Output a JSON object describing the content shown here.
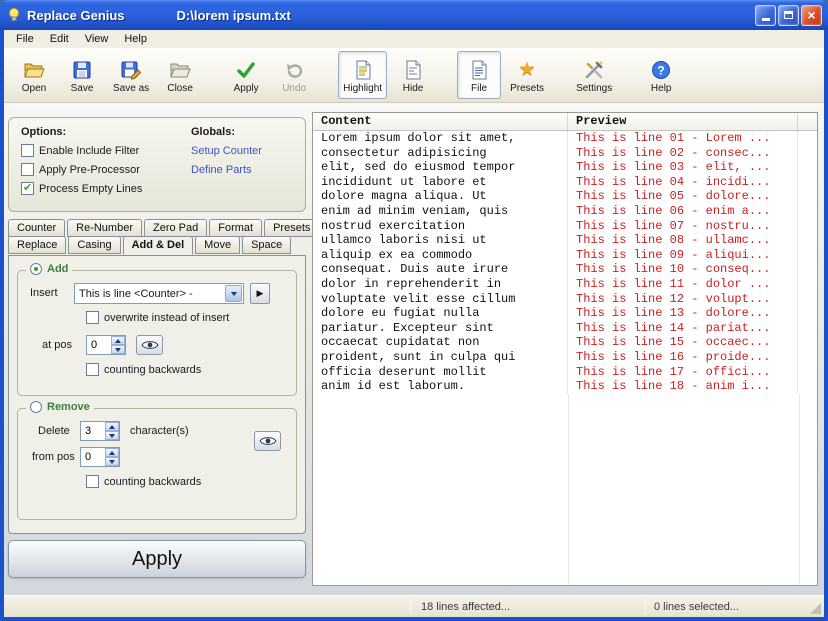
{
  "titlebar": {
    "app_title": "Replace Genius",
    "document_path": "D:\\lorem ipsum.txt"
  },
  "menu": {
    "items": [
      "File",
      "Edit",
      "View",
      "Help"
    ]
  },
  "toolbar": {
    "buttons": [
      "Open",
      "Save",
      "Save as",
      "Close",
      "Apply",
      "Undo",
      "Highlight",
      "Hide",
      "File",
      "Presets",
      "Settings",
      "Help"
    ]
  },
  "options_box": {
    "options_heading": "Options:",
    "checkboxes": [
      {
        "label": "Enable Include Filter",
        "checked": false
      },
      {
        "label": "Apply Pre-Processor",
        "checked": false
      },
      {
        "label": "Process Empty Lines",
        "checked": true
      }
    ],
    "globals_heading": "Globals:",
    "links": [
      "Setup Counter",
      "Define Parts"
    ]
  },
  "tabs": {
    "row1": [
      "Counter",
      "Re-Number",
      "Zero Pad",
      "Format",
      "Presets"
    ],
    "row2": [
      "Replace",
      "Casing",
      "Add & Del",
      "Move",
      "Space"
    ],
    "active": "Add & Del"
  },
  "add_section": {
    "legend": "Add",
    "insert_label": "Insert",
    "insert_value": "This is line <Counter> -",
    "overwrite_label": "overwrite instead of insert",
    "at_pos_label": "at pos",
    "at_pos_value": "0",
    "counting_backwards_label": "counting backwards"
  },
  "remove_section": {
    "legend": "Remove",
    "delete_label": "Delete",
    "delete_value": "3",
    "characters_label": "character(s)",
    "from_pos_label": "from pos",
    "from_pos_value": "0",
    "counting_backwards_label": "counting backwards"
  },
  "apply_button": {
    "label": "Apply"
  },
  "list": {
    "columns": [
      "Content",
      "Preview"
    ],
    "rows": [
      {
        "content": "Lorem ipsum dolor sit amet,",
        "preview": "This is line 01 - Lorem ..."
      },
      {
        "content": "consectetur adipisicing",
        "preview": "This is line 02 - consec..."
      },
      {
        "content": "elit, sed do eiusmod tempor",
        "preview": "This is line 03 - elit, ..."
      },
      {
        "content": "incididunt ut labore et",
        "preview": "This is line 04 - incidi..."
      },
      {
        "content": "dolore magna aliqua. Ut",
        "preview": "This is line 05 - dolore..."
      },
      {
        "content": "enim ad minim veniam, quis",
        "preview": "This is line 06 - enim a..."
      },
      {
        "content": "nostrud exercitation",
        "preview": "This is line 07 - nostru..."
      },
      {
        "content": "ullamco laboris nisi ut",
        "preview": "This is line 08 - ullamc..."
      },
      {
        "content": "aliquip ex ea commodo",
        "preview": "This is line 09 - aliqui..."
      },
      {
        "content": "consequat. Duis aute irure",
        "preview": "This is line 10 - conseq..."
      },
      {
        "content": "dolor in reprehenderit in",
        "preview": "This is line 11 - dolor ..."
      },
      {
        "content": "voluptate velit esse cillum",
        "preview": "This is line 12 - volupt..."
      },
      {
        "content": "dolore eu fugiat nulla",
        "preview": "This is line 13 - dolore..."
      },
      {
        "content": "pariatur. Excepteur sint",
        "preview": "This is line 14 - pariat..."
      },
      {
        "content": "occaecat cupidatat non",
        "preview": "This is line 15 - occaec..."
      },
      {
        "content": "proident, sunt in culpa qui",
        "preview": "This is line 16 - proide..."
      },
      {
        "content": "officia deserunt mollit",
        "preview": "This is line 17 - offici..."
      },
      {
        "content": "anim id est laborum.",
        "preview": "This is line 18 - anim i..."
      }
    ]
  },
  "statusbar": {
    "lines_affected": "18 lines affected...",
    "lines_selected": "0 lines selected..."
  },
  "colors": {
    "titlebar_blue": "#2a60da",
    "preview_red": "#cc2020",
    "link_blue": "#3a55c8",
    "check_green": "#2fa12f"
  }
}
